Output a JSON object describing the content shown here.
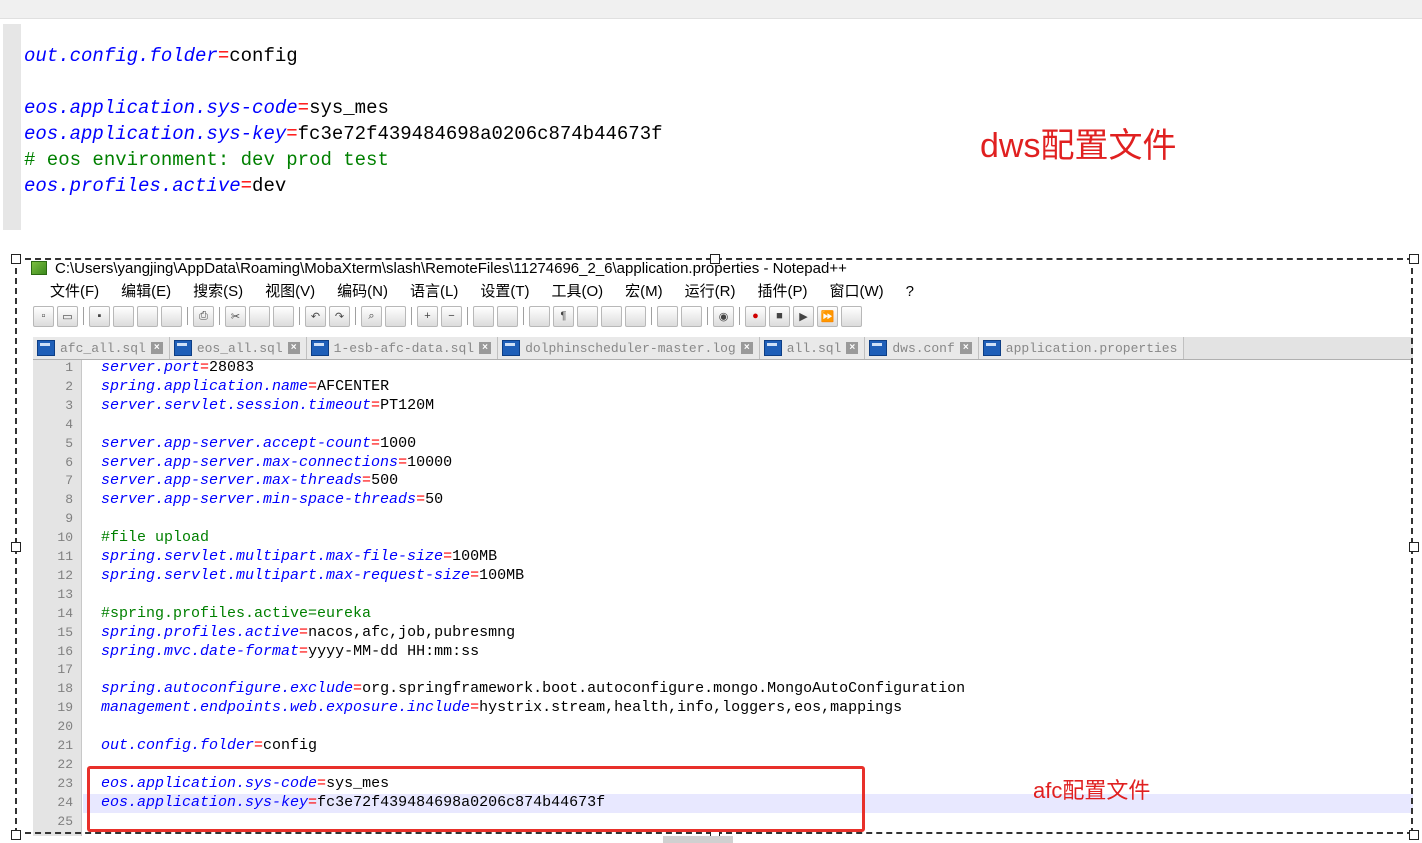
{
  "background_snippet": {
    "lines": [
      {
        "type": "kv",
        "key": "out.config.folder",
        "value": "config"
      },
      {
        "type": "blank"
      },
      {
        "type": "kv",
        "key": "eos.application.sys-code",
        "value": "sys_mes"
      },
      {
        "type": "kv",
        "key": "eos.application.sys-key",
        "value": "fc3e72f439484698a0206c874b44673f"
      },
      {
        "type": "comment",
        "text": "# eos environment: dev prod test"
      },
      {
        "type": "kv",
        "key": "eos.profiles.active",
        "value": "dev"
      }
    ],
    "annotation": "dws配置文件",
    "annotation_color": "#e02020"
  },
  "notepad": {
    "title": "C:\\Users\\yangjing\\AppData\\Roaming\\MobaXterm\\slash\\RemoteFiles\\11274696_2_6\\application.properties - Notepad++",
    "menu": [
      "文件(F)",
      "编辑(E)",
      "搜索(S)",
      "视图(V)",
      "编码(N)",
      "语言(L)",
      "设置(T)",
      "工具(O)",
      "宏(M)",
      "运行(R)",
      "插件(P)",
      "窗口(W)",
      "?"
    ],
    "tabs": [
      "afc_all.sql",
      "eos_all.sql",
      "1-esb-afc-data.sql",
      "dolphinscheduler-master.log",
      "all.sql",
      "dws.conf",
      "application.properties"
    ],
    "toolbar_icons": [
      "new-icon",
      "open-icon",
      "save-icon",
      "save-all-icon",
      "close-icon",
      "close-all-icon",
      "print-icon",
      "cut-icon",
      "copy-icon",
      "paste-icon",
      "undo-icon",
      "redo-icon",
      "find-icon",
      "replace-icon",
      "zoom-in-icon",
      "zoom-out-icon",
      "sync-v-icon",
      "sync-h-icon",
      "wrap-icon",
      "all-chars-icon",
      "indent-guide-icon",
      "udl-icon",
      "doc-map-icon",
      "func-list-icon",
      "folder-icon",
      "monitor-icon",
      "record-macro-icon",
      "stop-macro-icon",
      "play-macro-icon",
      "run-macro-icon",
      "save-macro-icon"
    ],
    "lines": [
      {
        "n": "1",
        "type": "kv",
        "key": "server.port",
        "value": "28083"
      },
      {
        "n": "2",
        "type": "kv",
        "key": "spring.application.name",
        "value": "AFCENTER"
      },
      {
        "n": "3",
        "type": "kv",
        "key": "server.servlet.session.timeout",
        "value": "PT120M"
      },
      {
        "n": "4",
        "type": "blank"
      },
      {
        "n": "5",
        "type": "kv",
        "key": "server.app-server.accept-count",
        "value": "1000"
      },
      {
        "n": "6",
        "type": "kv",
        "key": "server.app-server.max-connections",
        "value": "10000"
      },
      {
        "n": "7",
        "type": "kv",
        "key": "server.app-server.max-threads",
        "value": "500"
      },
      {
        "n": "8",
        "type": "kv",
        "key": "server.app-server.min-space-threads",
        "value": "50"
      },
      {
        "n": "9",
        "type": "blank"
      },
      {
        "n": "10",
        "type": "comment",
        "text": "#file upload"
      },
      {
        "n": "11",
        "type": "kv",
        "key": "spring.servlet.multipart.max-file-size",
        "value": "100MB"
      },
      {
        "n": "12",
        "type": "kv",
        "key": "spring.servlet.multipart.max-request-size",
        "value": "100MB"
      },
      {
        "n": "13",
        "type": "blank"
      },
      {
        "n": "14",
        "type": "comment",
        "text": "#spring.profiles.active=eureka"
      },
      {
        "n": "15",
        "type": "kv",
        "key": "spring.profiles.active",
        "value": "nacos,afc,job,pubresmng"
      },
      {
        "n": "16",
        "type": "kv",
        "key": "spring.mvc.date-format",
        "value": "yyyy-MM-dd HH:mm:ss"
      },
      {
        "n": "17",
        "type": "blank"
      },
      {
        "n": "18",
        "type": "kv",
        "key": "spring.autoconfigure.exclude",
        "value": "org.springframework.boot.autoconfigure.mongo.MongoAutoConfiguration"
      },
      {
        "n": "19",
        "type": "kv",
        "key": "management.endpoints.web.exposure.include",
        "value": "hystrix.stream,health,info,loggers,eos,mappings"
      },
      {
        "n": "20",
        "type": "blank"
      },
      {
        "n": "21",
        "type": "kv",
        "key": "out.config.folder",
        "value": "config"
      },
      {
        "n": "22",
        "type": "blank"
      },
      {
        "n": "23",
        "type": "kv",
        "key": "eos.application.sys-code",
        "value": "sys_mes"
      },
      {
        "n": "24",
        "type": "kv",
        "key": "eos.application.sys-key",
        "value": "fc3e72f439484698a0206c874b44673f"
      },
      {
        "n": "25",
        "type": "blank"
      }
    ]
  },
  "afc_annotation": "afc配置文件",
  "colors": {
    "key": "#0000ff",
    "equals": "#ff0000",
    "comment": "#008000",
    "annotation": "#e02020"
  }
}
